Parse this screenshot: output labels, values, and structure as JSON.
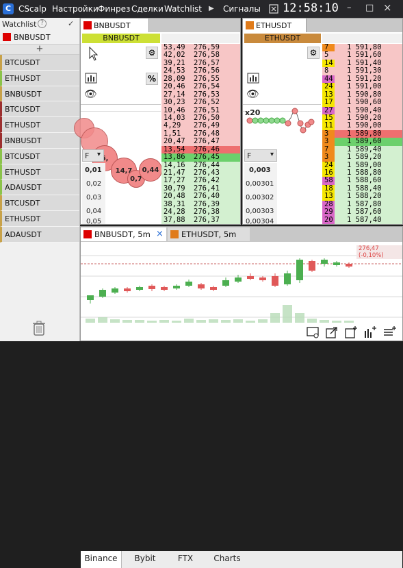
{
  "titlebar": {
    "app": "CScalp",
    "menu": [
      "Настройки",
      "Финрез",
      "Сделки",
      "Watchlist"
    ],
    "signals": "Сигналы",
    "clock": "12:58:10",
    "logo_letter": "C"
  },
  "sidebar": {
    "title": "Watchlist",
    "help": "?",
    "current_symbol": "BNBUSDT",
    "current_color": "#dd0000",
    "add": "+",
    "items": [
      {
        "label": "BTCUSDT",
        "bar": "#c8a24a"
      },
      {
        "label": "ETHUSDT",
        "bar": "#8bc34a"
      },
      {
        "label": "BNBUSDT",
        "bar": "#c8a24a"
      },
      {
        "label": "BTCUSDT",
        "bar": "#9c2f2f"
      },
      {
        "label": "ETHUSDT",
        "bar": "#9c2f2f"
      },
      {
        "label": "BNBUSDT",
        "bar": "#9c2f2f"
      },
      {
        "label": "BTCUSDT",
        "bar": "#8bc34a"
      },
      {
        "label": "ETHUSDT",
        "bar": "#8bc34a"
      },
      {
        "label": "ADAUSDT",
        "bar": "#8bc34a"
      },
      {
        "label": "BTCUSDT",
        "bar": "#c8a24a"
      },
      {
        "label": "ETHUSDT",
        "bar": "#c8a24a"
      },
      {
        "label": "ADAUSDT",
        "bar": "#c8a24a"
      }
    ]
  },
  "bnb": {
    "tab": "BNBUSDT",
    "tab_color": "#dd0000",
    "header": "BNBUSDT",
    "header_bg": "#cde035",
    "percent_btn": "%",
    "dropdown": "F",
    "levels": [
      "0,01",
      "0,02",
      "0,03",
      "0,04",
      "0,05"
    ],
    "bubbles": [
      "6,",
      "14,7",
      "0,7",
      "0,44"
    ],
    "rows": [
      [
        "53,49",
        "276,59",
        "ask"
      ],
      [
        "42,02",
        "276,58",
        "ask"
      ],
      [
        "39,21",
        "276,57",
        "ask"
      ],
      [
        "24,53",
        "276,56",
        "ask"
      ],
      [
        "28,09",
        "276,55",
        "ask"
      ],
      [
        "20,46",
        "276,54",
        "ask"
      ],
      [
        "27,14",
        "276,53",
        "ask"
      ],
      [
        "30,23",
        "276,52",
        "ask"
      ],
      [
        "10,46",
        "276,51",
        "ask"
      ],
      [
        "14,03",
        "276,50",
        "ask"
      ],
      [
        "4,29",
        "276,49",
        "ask"
      ],
      [
        "1,51",
        "276,48",
        "ask"
      ],
      [
        "20,47",
        "276,47",
        "ask"
      ],
      [
        "13,54",
        "276,46",
        "bestask"
      ],
      [
        "13,86",
        "276,45",
        "bestbid"
      ],
      [
        "14,16",
        "276,44",
        "bid"
      ],
      [
        "21,47",
        "276,43",
        "bid"
      ],
      [
        "17,27",
        "276,42",
        "bid"
      ],
      [
        "30,79",
        "276,41",
        "bid"
      ],
      [
        "20,48",
        "276,40",
        "bid"
      ],
      [
        "38,31",
        "276,39",
        "bid"
      ],
      [
        "24,28",
        "276,38",
        "bid"
      ],
      [
        "37,88",
        "276,37",
        "bid"
      ]
    ]
  },
  "eth": {
    "tab": "ETHUSDT",
    "tab_color": "#e07b1a",
    "header": "ETHUSDT",
    "header_bg": "#c98a3c",
    "dropdown": "F",
    "levels": [
      "0,003",
      "0,00301",
      "0,00302",
      "0,00303",
      "0,00304"
    ],
    "x_label": "x20",
    "rows": [
      [
        "7",
        "1 591,80",
        "ask",
        "#f08a1c"
      ],
      [
        "5",
        "1 591,60",
        "ask",
        ""
      ],
      [
        "14",
        "1 591,40",
        "ask",
        "#f5e600"
      ],
      [
        "8",
        "1 591,30",
        "ask",
        ""
      ],
      [
        "44",
        "1 591,20",
        "ask",
        "#d968c8"
      ],
      [
        "24",
        "1 591,00",
        "ask",
        "#f5e600"
      ],
      [
        "13",
        "1 590,80",
        "ask",
        "#f5e600"
      ],
      [
        "17",
        "1 590,60",
        "ask",
        "#f5e600"
      ],
      [
        "27",
        "1 590,40",
        "ask",
        "#d968c8"
      ],
      [
        "15",
        "1 590,20",
        "ask",
        "#f5e600"
      ],
      [
        "11",
        "1 590,00",
        "ask",
        "#f5e600"
      ],
      [
        "3",
        "1 589,80",
        "bestask",
        "#f08a1c"
      ],
      [
        "3",
        "1 589,60",
        "bestbid",
        "#f08a1c"
      ],
      [
        "7",
        "1 589,40",
        "bid",
        "#f08a1c"
      ],
      [
        "3",
        "1 589,20",
        "bid",
        "#f08a1c"
      ],
      [
        "24",
        "1 589,00",
        "bid",
        "#f5e600"
      ],
      [
        "16",
        "1 588,80",
        "bid",
        "#f5e600"
      ],
      [
        "58",
        "1 588,60",
        "bid",
        "#d968c8"
      ],
      [
        "18",
        "1 588,40",
        "bid",
        "#f5e600"
      ],
      [
        "13",
        "1 588,20",
        "bid",
        "#f5e600"
      ],
      [
        "28",
        "1 587,80",
        "bid",
        "#d968c8"
      ],
      [
        "29",
        "1 587,60",
        "bid",
        "#d968c8"
      ],
      [
        "20",
        "1 587,40",
        "bid",
        "#d968c8"
      ]
    ]
  },
  "chart": {
    "tabs": [
      {
        "label": "BNBUSDT, 5m",
        "color": "#dd0000",
        "close": "×"
      },
      {
        "label": "ETHUSDT, 5m",
        "color": "#e07b1a"
      }
    ],
    "price_tag": "276,47 (-0,10%)",
    "exchanges": [
      "Binance",
      "Bybit",
      "FTX",
      "Charts"
    ],
    "tools": [
      "settings-icon",
      "export-icon",
      "add-chart-icon",
      "indicator-icon",
      "list-icon"
    ]
  }
}
